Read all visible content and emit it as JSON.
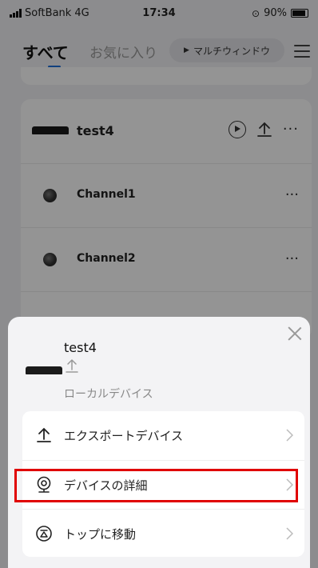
{
  "status_bar": {
    "carrier": "SoftBank",
    "network": "4G",
    "time": "17:34",
    "battery": "90%",
    "battery_level": 0.9
  },
  "header": {
    "tab_all": "すべて",
    "tab_favorites": "お気に入り",
    "multi_window_label": "マルチウィンドウ",
    "menu_icon": "hamburger-icon"
  },
  "device_list": {
    "device_name": "test4",
    "channels": [
      {
        "name": "Channel1"
      },
      {
        "name": "Channel2"
      }
    ]
  },
  "sheet": {
    "device_name": "test4",
    "device_type": "ローカルデバイス",
    "close_icon": "close-icon",
    "items": [
      {
        "label": "エクスポートデバイス",
        "icon": "export-icon"
      },
      {
        "label": "デバイスの詳細",
        "icon": "camera-icon"
      },
      {
        "label": "トップに移動",
        "icon": "move-top-icon"
      }
    ]
  },
  "colors": {
    "accent": "#1e6fd9",
    "highlight": "#e00000"
  }
}
